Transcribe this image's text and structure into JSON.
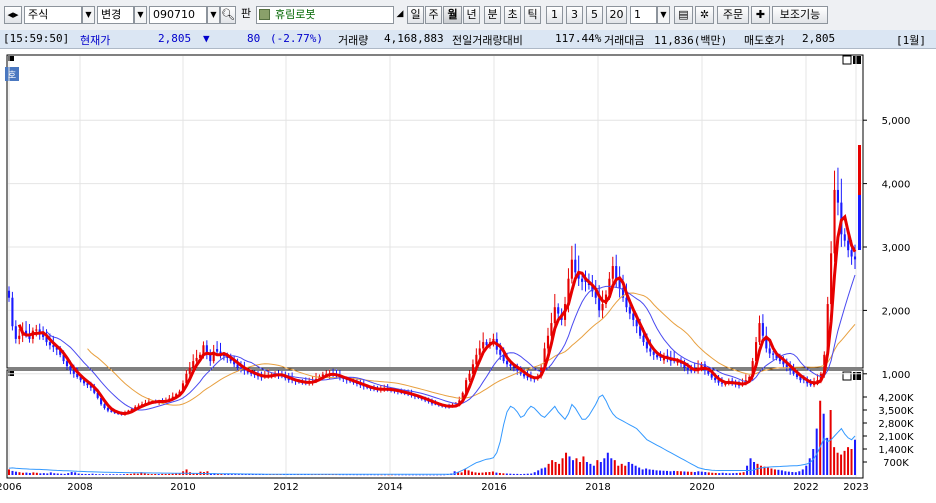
{
  "toolbar": {
    "nav_icon": "arrows-icon",
    "market": "주식",
    "change_label": "변경",
    "code": "090710",
    "pan_label": "판",
    "stock_name": "휴림로봇",
    "period_buttons": [
      "일",
      "주",
      "월",
      "년",
      "분",
      "초",
      "틱"
    ],
    "selected_period": "월",
    "interval_buttons": [
      "1",
      "3",
      "5",
      "20"
    ],
    "interval_value": "1",
    "order_label": "주문",
    "aux_label": "보조기능"
  },
  "info": {
    "time": "[15:59:50]",
    "price_label": "현재가",
    "price": "2,805",
    "direction": "▼",
    "change": "80",
    "change_pct": "(-2.77%)",
    "volume_label": "거래량",
    "volume": "4,168,883",
    "prev_vol_label": "전일거래량대비",
    "prev_vol_ratio": "117.44%",
    "amount_label": "거래대금",
    "amount": "11,836(백만)",
    "ask_label": "매도호가",
    "ask": "2,805",
    "period_tag": "[1월]"
  },
  "chart_panel_label": "호",
  "colors": {
    "up": "#e60000",
    "down": "#1a1aff",
    "ma_short": "#4a4af0",
    "ma_long": "#e8a040",
    "vol_ma": "#3399ff"
  },
  "chart_data": {
    "type": "candlestick",
    "x_axis_labels": [
      "2006",
      "2008",
      "2010",
      "2012",
      "2014",
      "2016",
      "2018",
      "2020",
      "2022",
      "2023"
    ],
    "price_axis": {
      "ticks": [
        "1,000",
        "2,000",
        "3,000",
        "4,000",
        "5,000"
      ],
      "range": [
        0,
        5300
      ]
    },
    "volume_axis": {
      "ticks": [
        "700K",
        "1,400K",
        "2,100K",
        "2,800K",
        "3,500K",
        "4,200K"
      ],
      "range": [
        0,
        4600
      ]
    },
    "monthly_close": [
      2200,
      1750,
      1550,
      1600,
      1680,
      1620,
      1550,
      1680,
      1700,
      1640,
      1580,
      1500,
      1450,
      1420,
      1380,
      1300,
      1200,
      1120,
      1050,
      1000,
      950,
      900,
      850,
      820,
      780,
      700,
      620,
      520,
      460,
      420,
      400,
      380,
      370,
      360,
      380,
      420,
      450,
      480,
      500,
      520,
      540,
      560,
      570,
      560,
      560,
      560,
      580,
      610,
      640,
      680,
      720,
      850,
      1000,
      1100,
      1200,
      1250,
      1300,
      1450,
      1300,
      1200,
      1350,
      1350,
      1300,
      1280,
      1250,
      1200,
      1150,
      1100,
      1080,
      1050,
      1020,
      1000,
      980,
      960,
      950,
      960,
      970,
      990,
      1000,
      980,
      960,
      930,
      900,
      900,
      880,
      870,
      860,
      860,
      870,
      880,
      920,
      960,
      990,
      1000,
      1000,
      980,
      960,
      940,
      920,
      900,
      880,
      860,
      840,
      820,
      800,
      780,
      760,
      760,
      750,
      760,
      760,
      750,
      740,
      730,
      720,
      700,
      690,
      680,
      660,
      640,
      620,
      600,
      580,
      560,
      530,
      520,
      500,
      490,
      480,
      480,
      500,
      510,
      580,
      700,
      900,
      1000,
      1150,
      1300,
      1400,
      1500,
      1450,
      1500,
      1550,
      1380,
      1300,
      1200,
      1150,
      1120,
      1100,
      1050,
      1000,
      960,
      940,
      930,
      920,
      960,
      1100,
      1400,
      1600,
      1800,
      2050,
      1950,
      1850,
      2100,
      2500,
      2800,
      2600,
      2500,
      2450,
      2450,
      2400,
      2300,
      2200,
      2000,
      2100,
      2250,
      2500,
      2700,
      2500,
      2350,
      2200,
      2050,
      1950,
      1850,
      1750,
      1600,
      1500,
      1400,
      1350,
      1300,
      1260,
      1250,
      1250,
      1250,
      1200,
      1200,
      1210,
      1160,
      1100,
      1060,
      1040,
      1050,
      1100,
      1150,
      1050,
      1000,
      940,
      900,
      860,
      850,
      850,
      890,
      850,
      830,
      820,
      850,
      900,
      950,
      1200,
      1500,
      1800,
      1600,
      1400,
      1320,
      1300,
      1250,
      1200,
      1150,
      1100,
      1050,
      1000,
      950,
      900,
      900,
      850,
      820,
      860,
      900,
      1000,
      1300,
      2100,
      2900,
      3900,
      3700,
      3200,
      3100,
      2950,
      2850,
      2805
    ],
    "monthly_volume_k": [
      300,
      220,
      180,
      150,
      120,
      130,
      110,
      140,
      120,
      90,
      100,
      85,
      140,
      95,
      80,
      70,
      60,
      100,
      160,
      140,
      75,
      60,
      55,
      50,
      70,
      45,
      40,
      45,
      35,
      40,
      40,
      35,
      38,
      45,
      55,
      60,
      80,
      70,
      150,
      90,
      60,
      50,
      55,
      50,
      60,
      55,
      60,
      70,
      80,
      90,
      200,
      300,
      150,
      100,
      90,
      180,
      160,
      200,
      90,
      100,
      60,
      55,
      50,
      50,
      45,
      45,
      40,
      38,
      35,
      36,
      40,
      38,
      35,
      34,
      40,
      35,
      32,
      30,
      35,
      38,
      36,
      34,
      30,
      28,
      30,
      26,
      27,
      25,
      28,
      30,
      35,
      40,
      30,
      25,
      24,
      22,
      21,
      20,
      22,
      20,
      18,
      19,
      18,
      17,
      20,
      16,
      15,
      15,
      16,
      14,
      15,
      14,
      13,
      14,
      13,
      12,
      13,
      12,
      12,
      12,
      12,
      11,
      10,
      11,
      12,
      14,
      30,
      80,
      200,
      150,
      140,
      300,
      250,
      180,
      140,
      120,
      130,
      150,
      160,
      190,
      130,
      110,
      90,
      80,
      70,
      60,
      60,
      50,
      60,
      70,
      80,
      150,
      250,
      350,
      400,
      600,
      800,
      700,
      600,
      900,
      1200,
      1000,
      800,
      900,
      700,
      1000,
      700,
      600,
      500,
      800,
      700,
      900,
      1200,
      900,
      800,
      500,
      600,
      500,
      700,
      600,
      500,
      400,
      300,
      350,
      300,
      280,
      250,
      240,
      230,
      220,
      200,
      220,
      210,
      200,
      190,
      180,
      170,
      160,
      200,
      180,
      160,
      140,
      120,
      110,
      100,
      120,
      100,
      90,
      100,
      110,
      120,
      150,
      500,
      900,
      700,
      600,
      500,
      450,
      400,
      350,
      300,
      280,
      250,
      200,
      180,
      160,
      150,
      200,
      300,
      500,
      900,
      1400,
      2500,
      4000,
      3300,
      2000,
      3500,
      1500,
      1200,
      1100,
      1300,
      1500,
      1400,
      1900
    ],
    "volume_ma_shape": [
      360,
      380,
      360,
      350,
      340,
      330,
      320,
      310,
      300,
      300,
      290,
      280,
      270,
      260,
      250,
      240,
      230,
      225,
      220,
      210,
      200,
      195,
      190,
      180,
      170,
      165,
      160,
      155,
      150,
      145,
      140,
      138,
      135,
      133,
      130,
      128,
      125,
      122,
      120,
      118,
      115,
      112,
      110,
      108,
      106,
      104,
      102,
      100,
      98,
      96,
      94,
      92,
      90,
      88,
      86,
      84,
      82,
      80,
      78,
      76,
      74,
      72,
      70,
      68,
      66,
      64,
      62,
      60,
      58,
      56,
      54,
      52,
      50,
      48,
      46,
      44,
      42,
      40,
      40,
      40,
      40,
      40,
      40,
      40,
      40,
      40,
      40,
      40,
      40,
      40,
      40,
      40,
      40,
      40,
      40,
      40,
      40,
      40,
      40,
      40,
      40,
      40,
      40,
      40,
      40,
      40,
      40,
      40,
      40,
      40,
      40,
      40,
      40,
      40,
      40,
      40,
      40,
      40,
      40,
      40,
      40,
      40,
      40,
      40,
      40,
      40,
      40,
      40,
      40,
      40,
      50,
      100,
      180,
      260,
      350,
      460,
      560,
      660,
      720,
      790,
      850,
      880,
      930,
      1200,
      1800,
      2700,
      3400,
      3700,
      3600,
      3400,
      3100,
      3200,
      3500,
      3700,
      3600,
      3400,
      3200,
      3100,
      3300,
      3500,
      3700,
      3400,
      3200,
      3000,
      3300,
      3800,
      3600,
      3300,
      3000,
      3000,
      3200,
      3500,
      3800,
      4200,
      4300,
      4000,
      3600,
      3300,
      3100,
      3000,
      2900,
      2800,
      2700,
      2600,
      2500,
      2300,
      2100,
      1900,
      1800,
      1700,
      1600,
      1500,
      1400,
      1300,
      1200,
      1100,
      1000,
      900,
      800,
      700,
      600,
      500,
      400,
      350,
      300,
      280,
      260,
      250,
      240,
      240,
      240,
      240,
      240,
      240,
      240,
      240,
      240,
      240,
      260,
      320,
      360,
      400,
      420,
      430,
      440,
      450,
      460,
      470,
      480,
      490,
      500,
      500,
      520,
      560,
      600,
      700,
      900,
      1200,
      1600,
      2000,
      1800,
      1900,
      2100,
      2300,
      2500,
      2200,
      2000,
      1900,
      2100
    ]
  }
}
